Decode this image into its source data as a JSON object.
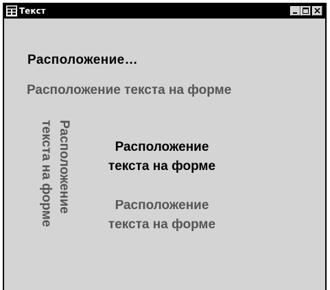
{
  "window": {
    "title": "Текст",
    "controls": {
      "minimize_icon": "minimize-icon",
      "maximize_icon": "maximize-icon",
      "close_icon": "close-icon"
    }
  },
  "form": {
    "label_short": "Расположение…",
    "label_horizontal": "Расположение текста на форме",
    "vertical_lines": [
      "Расположение",
      "текста на форме"
    ],
    "centered_lines": [
      "Расположение",
      "текста на форме"
    ],
    "clipped_lines": [
      "Расположение",
      "текста на форме"
    ]
  },
  "colors": {
    "titlebar": "#000000",
    "client": "#d4d4d4",
    "text_dark": "#000000",
    "text_gray": "#555555"
  }
}
